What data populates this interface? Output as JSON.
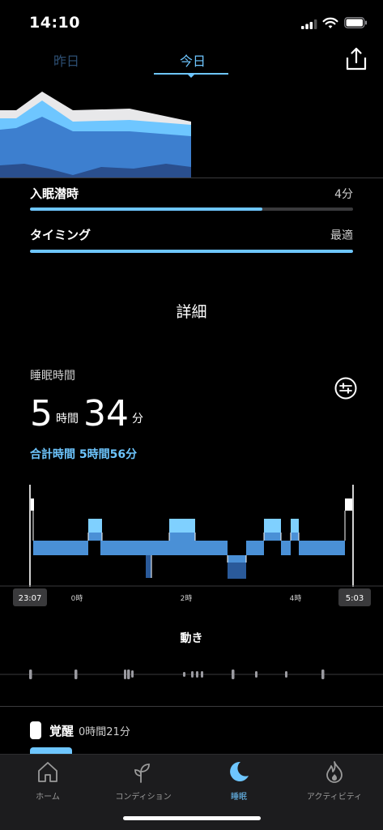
{
  "status_bar": {
    "time": "14:10"
  },
  "tabs": {
    "yesterday": "昨日",
    "today": "今日"
  },
  "metrics": [
    {
      "label": "入眠潜時",
      "value": "4分",
      "fill": 0.72
    },
    {
      "label": "タイミング",
      "value": "最適",
      "fill": 1.0
    }
  ],
  "details_heading": "詳細",
  "sleep_time": {
    "label": "睡眠時間",
    "hours": "5",
    "hours_unit": "時間",
    "minutes": "34",
    "minutes_unit": "分",
    "total": "合計時間 5時間56分"
  },
  "chart_data": {
    "type": "hypnogram",
    "start_label": "23:07",
    "end_label": "5:03",
    "tick_labels": [
      "0時",
      "2時",
      "4時"
    ],
    "stage_colors": {
      "awake": "#ffffff",
      "rem": "#7fd0ff",
      "light": "#4a90d6",
      "deep": "#2a5a9a"
    }
  },
  "movement": {
    "title": "動き"
  },
  "legend": {
    "name": "覚醒",
    "value": "0時間21分"
  },
  "nav": {
    "items": [
      {
        "label": "ホーム",
        "icon": "home-icon"
      },
      {
        "label": "コンディション",
        "icon": "sprout-icon"
      },
      {
        "label": "睡眠",
        "icon": "moon-icon"
      },
      {
        "label": "アクティビティ",
        "icon": "flame-icon"
      }
    ],
    "active": "睡眠"
  }
}
